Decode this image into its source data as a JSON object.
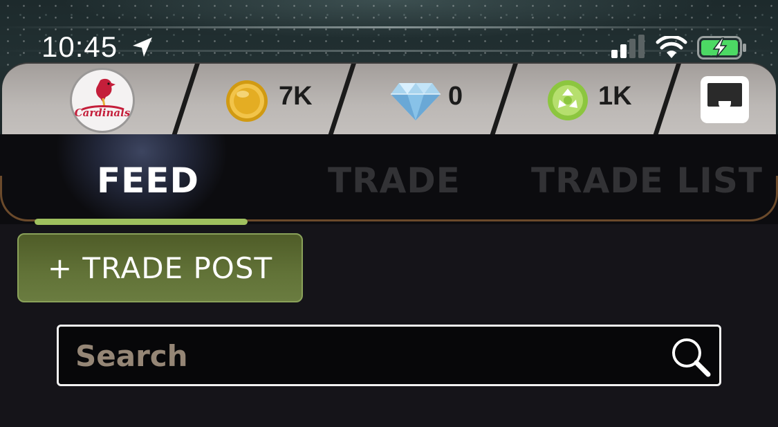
{
  "status_bar": {
    "time": "10:45",
    "icons": [
      "location-arrow-icon",
      "signal-icon",
      "wifi-icon",
      "battery-charging-icon"
    ]
  },
  "currency_bar": {
    "team_logo": "cardinals-logo",
    "team_logo_text": "Cardinals",
    "coins": {
      "icon": "coin-icon",
      "value": "7K"
    },
    "gems": {
      "icon": "diamond-icon",
      "value": "0"
    },
    "xp": {
      "icon": "recycle-icon",
      "value": "1K"
    },
    "inbox_icon": "inbox-icon"
  },
  "tabs": [
    {
      "label": "FEED",
      "active": true
    },
    {
      "label": "TRADE",
      "active": false
    },
    {
      "label": "TRADE LIST",
      "active": false
    }
  ],
  "trade_post": {
    "label": "+ TRADE POST"
  },
  "search": {
    "placeholder": "Search",
    "value": "",
    "icon": "search-icon"
  },
  "colors": {
    "accent_green": "#9fc05e",
    "button_green": "#627338",
    "placeholder": "#958676",
    "background": "#151419"
  }
}
